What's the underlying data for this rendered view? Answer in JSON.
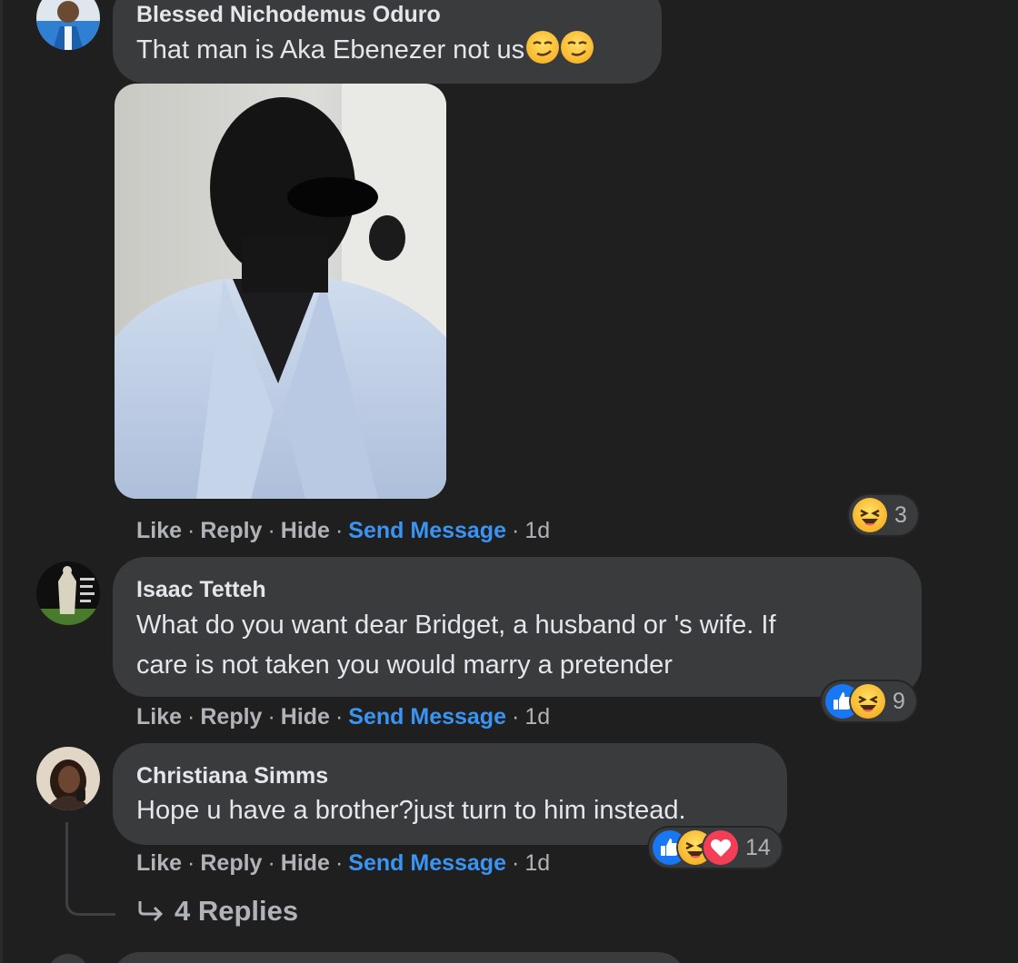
{
  "comments": [
    {
      "author": "Blessed Nichodemus Oduro",
      "text": "That man is Aka Ebenezer not us",
      "emoji": [
        "smirk-face",
        "smirk-face"
      ],
      "actions": {
        "like": "Like",
        "reply": "Reply",
        "hide": "Hide",
        "send_message": "Send Message",
        "time": "1d"
      },
      "reactions": {
        "types": [
          "haha"
        ],
        "count": "3"
      }
    },
    {
      "author": "Isaac Tetteh",
      "text_lines": [
        "What do you want dear Bridget, a husband or 's wife. If",
        "care is not taken you would marry a pretender"
      ],
      "actions": {
        "like": "Like",
        "reply": "Reply",
        "hide": "Hide",
        "send_message": "Send Message",
        "time": "1d"
      },
      "reactions": {
        "types": [
          "like",
          "haha"
        ],
        "count": "9"
      }
    },
    {
      "author": "Christiana Simms",
      "text": "Hope u have a brother?just turn to him instead.",
      "actions": {
        "like": "Like",
        "reply": "Reply",
        "hide": "Hide",
        "send_message": "Send Message",
        "time": "1d"
      },
      "reactions": {
        "types": [
          "like",
          "haha",
          "love"
        ],
        "count": "14"
      },
      "replies_label": "4 Replies"
    }
  ],
  "separator": "·",
  "colors": {
    "background": "#1f1f20",
    "bubble": "#3a3b3c",
    "text": "#e4e6eb",
    "muted": "#b0b3b8",
    "link": "#3a94f2"
  }
}
